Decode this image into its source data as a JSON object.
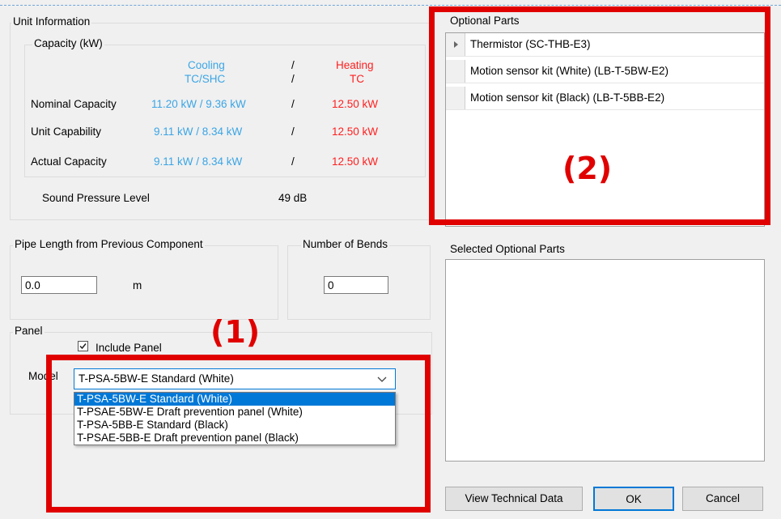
{
  "unit_info": {
    "title": "Unit Information",
    "capacity_group": "Capacity (kW)",
    "cooling_header": "Cooling",
    "cooling_sub": "TC/SHC",
    "slash": "/",
    "heating_header": "Heating",
    "heating_sub": "TC",
    "rows": [
      {
        "label": "Nominal Capacity",
        "cooling": "11.20 kW / 9.36 kW",
        "heating": "12.50 kW"
      },
      {
        "label": "Unit Capability",
        "cooling": "9.11 kW / 8.34 kW",
        "heating": "12.50 kW"
      },
      {
        "label": "Actual Capacity",
        "cooling": "9.11 kW / 8.34 kW",
        "heating": "12.50 kW"
      }
    ],
    "sound_label": "Sound Pressure Level",
    "sound_value": "49 dB"
  },
  "pipe": {
    "label": "Pipe Length from Previous Component",
    "value": "0.0",
    "unit": "m"
  },
  "bends": {
    "label": "Number of Bends",
    "value": "0"
  },
  "panel": {
    "title": "Panel",
    "include_label": "Include Panel",
    "model_label": "Model",
    "selected": "T-PSA-5BW-E Standard (White)",
    "options": [
      "T-PSA-5BW-E Standard (White)",
      "T-PSAE-5BW-E Draft prevention panel (White)",
      "T-PSA-5BB-E Standard (Black)",
      "T-PSAE-5BB-E Draft prevention panel (Black)"
    ]
  },
  "optional_parts": {
    "title": "Optional Parts",
    "items": [
      "Thermistor (SC-THB-E3)",
      "Motion sensor kit (White) (LB-T-5BW-E2)",
      "Motion sensor kit (Black) (LB-T-5BB-E2)"
    ]
  },
  "selected_parts": {
    "title": "Selected Optional Parts"
  },
  "buttons": {
    "view_tech": "View Technical Data",
    "ok": "OK",
    "cancel": "Cancel"
  },
  "annotations": {
    "label1": "(1)",
    "label2": "(2)"
  },
  "colors": {
    "cooling": "#3aa5e6",
    "heating": "#ff1f1f",
    "highlight": "#e00000",
    "selection": "#0078d7"
  }
}
